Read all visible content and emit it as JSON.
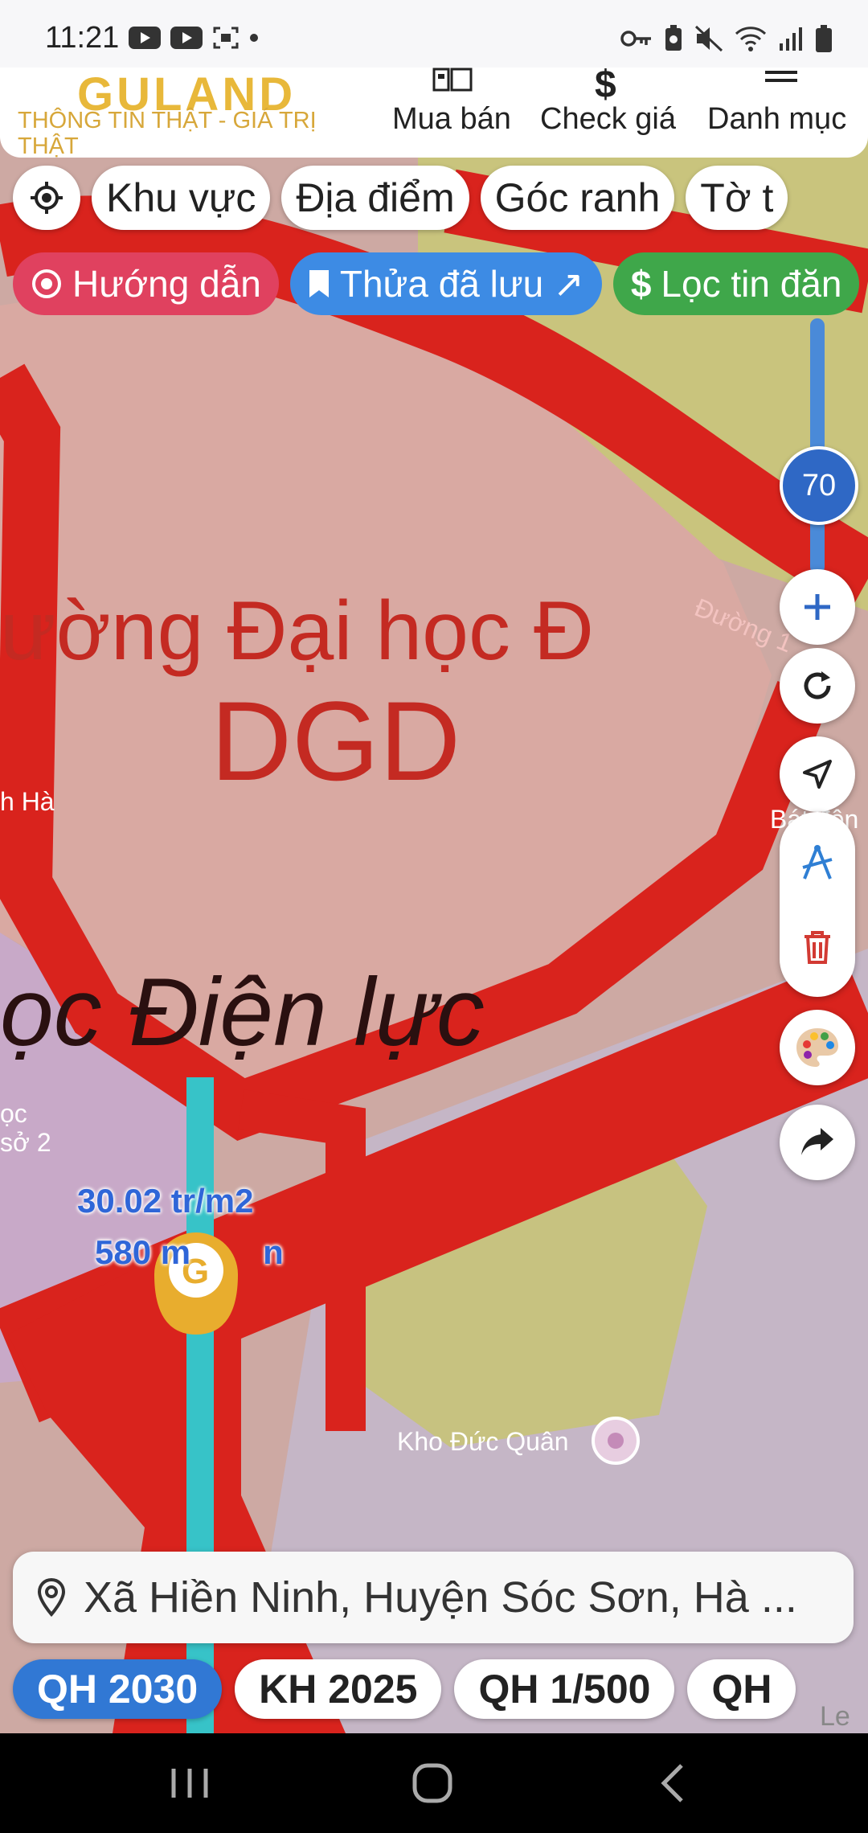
{
  "status_bar": {
    "time": "11:21",
    "left_icons": [
      "youtube-icon",
      "youtube-icon",
      "screen-record-icon",
      "dot-icon"
    ],
    "right_icons": [
      "key-icon",
      "battery-saver-icon",
      "mute-icon",
      "wifi-icon",
      "signal-icon",
      "battery-icon"
    ]
  },
  "header": {
    "logo": "GULAND",
    "tagline": "THÔNG TIN THẬT - GIÁ TRỊ THẬT",
    "nav": [
      {
        "label": "Mua bán",
        "icon": "building-icon"
      },
      {
        "label": "Check giá",
        "icon": "dollar-icon"
      },
      {
        "label": "Danh mục",
        "icon": "menu-icon"
      }
    ]
  },
  "filter_chips": {
    "locate_icon": "crosshair-icon",
    "items": [
      "Khu vực",
      "Địa điểm",
      "Góc ranh",
      "Tờ t"
    ]
  },
  "action_pills": [
    {
      "label": "Hướng dẫn",
      "icon": "play-circle-icon",
      "color": "#e0415f"
    },
    {
      "label": "Thửa đã lưu",
      "icon": "bookmark-icon",
      "suffix": "↗",
      "color": "#3d8be4"
    },
    {
      "label": "Lọc tin đăn",
      "icon": "dollar-icon",
      "color": "#3fa74a"
    }
  ],
  "map": {
    "labels": {
      "big_line1": "ường Đại học Đ",
      "big_line2": "DGD",
      "electric": "ọc Điện lực",
      "road": "Đường 1",
      "left_place": "h Hà",
      "bat_don": "Bát đôn",
      "coso": "ọc",
      "coso2": "sở 2",
      "poi": "Kho Đức Quân"
    },
    "price_label": {
      "price": "30.02 tr/m2",
      "area": "580 m",
      "area_suffix": "n"
    },
    "colors": {
      "planning_red": "#d9231d",
      "land_pink": "#d8a49f",
      "residential": "#c8a9c8",
      "agri_yellow": "#c5c27a",
      "water_cyan": "#37c3c8"
    }
  },
  "map_controls": {
    "zoom_level": "70",
    "buttons": [
      "plus-icon",
      "refresh-icon",
      "navigate-icon",
      "measure-icon",
      "trash-icon",
      "palette-icon",
      "share-icon"
    ]
  },
  "address": {
    "icon": "location-pin-icon",
    "text": "Xã Hiền Ninh, Huyện Sóc Sơn, Hà ..."
  },
  "layers": [
    {
      "label": "QH 2030",
      "active": true
    },
    {
      "label": "KH 2025",
      "active": false
    },
    {
      "label": "QH 1/500",
      "active": false
    },
    {
      "label": "QH",
      "active": false
    }
  ],
  "watermark": "Le"
}
